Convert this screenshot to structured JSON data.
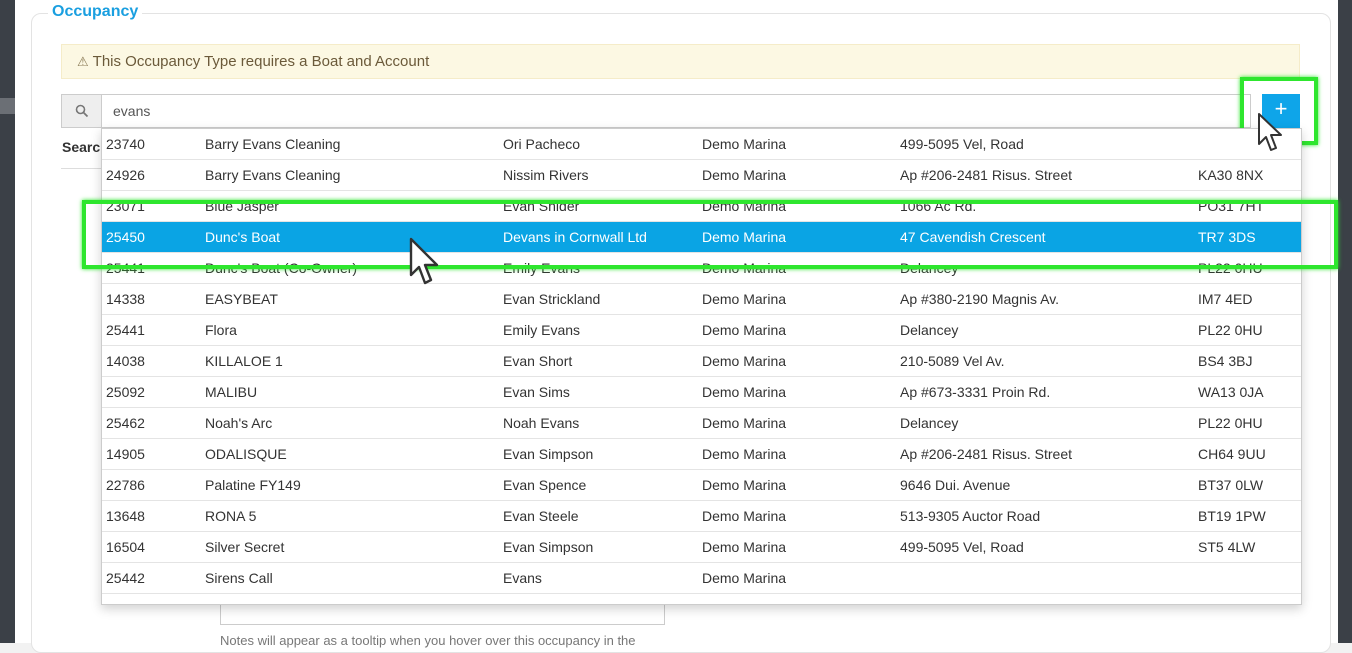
{
  "panel": {
    "title": "Occupancy"
  },
  "alert": {
    "icon": "warning-icon",
    "text": "This Occupancy Type requires a Boat and Account"
  },
  "search": {
    "icon": "search-icon",
    "value": "evans",
    "add_label": "+",
    "section_label": "Searc"
  },
  "notes": {
    "help_text": "Notes will appear as a tooltip when you hover over this occupancy in the"
  },
  "results": [
    [
      "23740",
      "Barry Evans Cleaning",
      "Ori Pacheco",
      "Demo Marina",
      "499-5095 Vel, Road",
      ""
    ],
    [
      "24926",
      "Barry Evans Cleaning",
      "Nissim Rivers",
      "Demo Marina",
      "Ap #206-2481 Risus. Street",
      "KA30 8NX"
    ],
    [
      "23071",
      "Blue Jasper",
      "Evan Snider",
      "Demo Marina",
      "1066 Ac Rd.",
      "PO31 7HT"
    ],
    [
      "25450",
      "Dunc's Boat",
      "Devans in Cornwall Ltd",
      "Demo Marina",
      "47 Cavendish Crescent",
      "TR7 3DS"
    ],
    [
      "25441",
      "Dunc's Boat (Co-Owner)",
      "Emily Evans",
      "Demo Marina",
      "Delancey",
      "PL22 0HU"
    ],
    [
      "14338",
      "EASYBEAT",
      "Evan Strickland",
      "Demo Marina",
      "Ap #380-2190 Magnis Av.",
      "IM7 4ED"
    ],
    [
      "25441",
      "Flora",
      "Emily Evans",
      "Demo Marina",
      "Delancey",
      "PL22 0HU"
    ],
    [
      "14038",
      "KILLALOE 1",
      "Evan Short",
      "Demo Marina",
      "210-5089 Vel Av.",
      "BS4 3BJ"
    ],
    [
      "25092",
      "MALIBU",
      "Evan Sims",
      "Demo Marina",
      "Ap #673-3331 Proin Rd.",
      "WA13 0JA"
    ],
    [
      "25462",
      "Noah's Arc",
      "Noah Evans",
      "Demo Marina",
      "Delancey",
      "PL22 0HU"
    ],
    [
      "14905",
      "ODALISQUE",
      "Evan Simpson",
      "Demo Marina",
      "Ap #206-2481 Risus. Street",
      "CH64 9UU"
    ],
    [
      "22786",
      "Palatine FY149",
      "Evan Spence",
      "Demo Marina",
      "9646 Dui. Avenue",
      "BT37 0LW"
    ],
    [
      "13648",
      "RONA 5",
      "Evan Steele",
      "Demo Marina",
      "513-9305 Auctor Road",
      "BT19 1PW"
    ],
    [
      "16504",
      "Silver Secret",
      "Evan Simpson",
      "Demo Marina",
      "499-5095 Vel, Road",
      "ST5 4LW"
    ],
    [
      "25442",
      "Sirens Call",
      "Evans",
      "Demo Marina",
      "",
      ""
    ]
  ],
  "selected_index": 3,
  "colors": {
    "accent": "#0aa4e4",
    "highlight": "#2ee62e",
    "alert_bg": "#fcf8e3"
  }
}
